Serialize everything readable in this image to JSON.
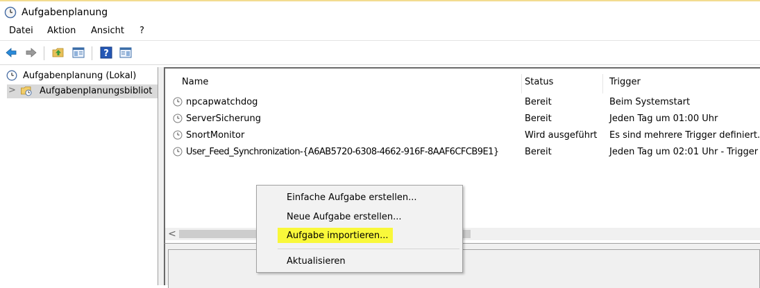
{
  "window": {
    "title": "Aufgabenplanung",
    "icon": "clock-icon"
  },
  "menubar": {
    "items": [
      "Datei",
      "Aktion",
      "Ansicht",
      "?"
    ]
  },
  "toolbar": {
    "buttons": [
      "back-arrow-icon",
      "forward-arrow-icon",
      "up-folder-icon",
      "show-hide-console-tree-icon",
      "help-icon",
      "show-hide-action-pane-icon"
    ]
  },
  "tree": {
    "items": [
      {
        "label": "Aufgabenplanung (Lokal)",
        "icon": "clock-icon"
      },
      {
        "label": "Aufgabenplanungsbibliot",
        "icon": "folder-clock-icon",
        "expander": ">"
      }
    ]
  },
  "tasks": {
    "columns": [
      "Name",
      "Status",
      "Trigger"
    ],
    "rows": [
      {
        "name": "npcapwatchdog",
        "status": "Bereit",
        "trigger": "Beim Systemstart"
      },
      {
        "name": "ServerSicherung",
        "status": "Bereit",
        "trigger": "Jeden Tag um 01:00 Uhr"
      },
      {
        "name": "SnortMonitor",
        "status": "Wird ausgeführt",
        "trigger": "Es sind mehrere Trigger definiert."
      },
      {
        "name": "User_Feed_Synchronization-{A6AB5720-6308-4662-916F-8AAF6CFCB9E1}",
        "status": "Bereit",
        "trigger": "Jeden Tag um 02:01 Uhr - Trigger"
      }
    ]
  },
  "scroll": {
    "left_arrow": "<"
  },
  "context_menu": {
    "items": [
      "Einfache Aufgabe erstellen...",
      "Neue Aufgabe erstellen...",
      "Aufgabe importieren...",
      "Aktualisieren"
    ],
    "highlight_color": "#f9f83a"
  }
}
